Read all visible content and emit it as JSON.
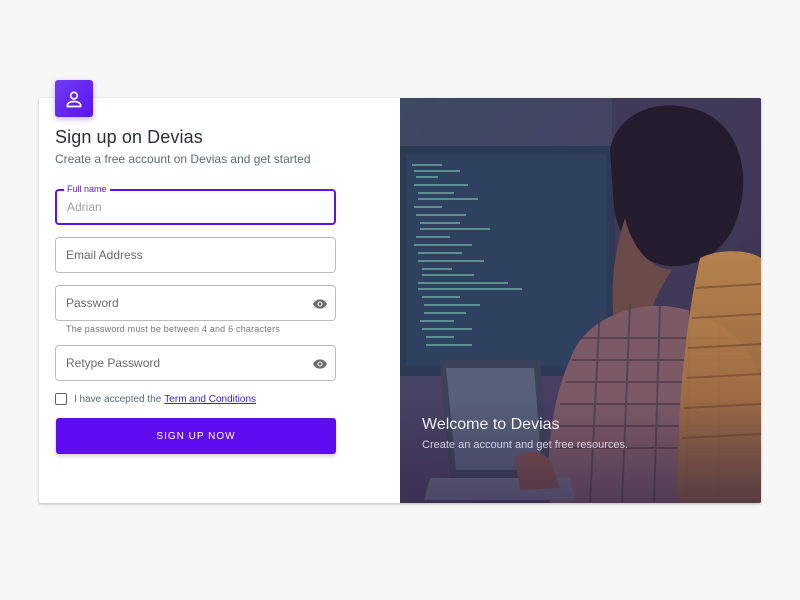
{
  "form": {
    "title": "Sign up on Devias",
    "subtitle": "Create a free account on Devias and get started",
    "full_name": {
      "label": "Full name",
      "placeholder": "Adrian"
    },
    "email": {
      "placeholder": "Email Address"
    },
    "password": {
      "placeholder": "Password",
      "helper": "The password must be between 4 and 6 characters"
    },
    "retype_password": {
      "placeholder": "Retype Password"
    },
    "terms": {
      "prefix": "I have accepted the",
      "link": "Term and Conditions",
      "checked": false
    },
    "submit_label": "SIGN UP NOW"
  },
  "hero": {
    "title": "Welcome to Devias",
    "subtitle": "Create an account and get free resources."
  },
  "icons": {
    "avatar": "person-icon",
    "password_toggle": "eye-icon",
    "retype_toggle": "eye-icon"
  },
  "colors": {
    "accent": "#5f0df0",
    "hero_overlay": "#4a3a6b"
  }
}
